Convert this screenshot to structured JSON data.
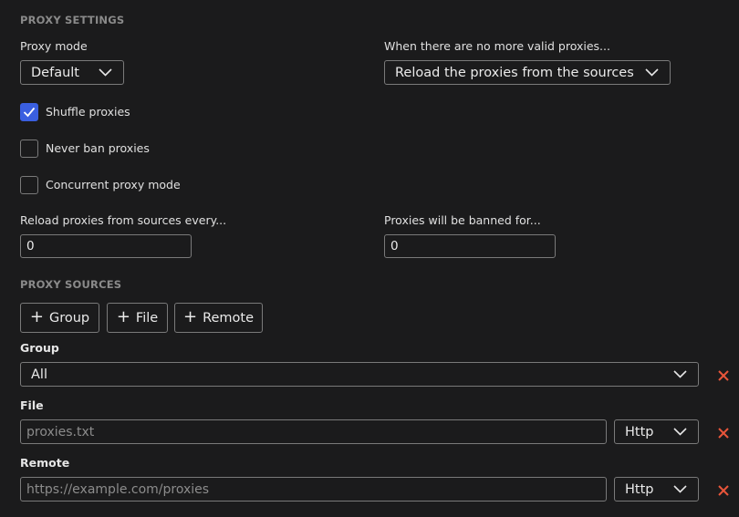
{
  "proxy_settings": {
    "title": "PROXY SETTINGS",
    "proxy_mode_label": "Proxy mode",
    "proxy_mode_value": "Default",
    "no_valid_label": "When there are no more valid proxies...",
    "no_valid_value": "Reload the proxies from the sources",
    "shuffle_label": "Shuffle proxies",
    "shuffle_checked": true,
    "never_ban_label": "Never ban proxies",
    "never_ban_checked": false,
    "concurrent_label": "Concurrent proxy mode",
    "concurrent_checked": false,
    "reload_label": "Reload proxies from sources every...",
    "reload_value": "0",
    "ban_label": "Proxies will be banned for...",
    "ban_value": "0"
  },
  "proxy_sources": {
    "title": "PROXY SOURCES",
    "add_group_label": "Group",
    "add_file_label": "File",
    "add_remote_label": "Remote",
    "group": {
      "label": "Group",
      "value": "All"
    },
    "file": {
      "label": "File",
      "placeholder": "proxies.txt",
      "type_value": "Http"
    },
    "remote": {
      "label": "Remote",
      "placeholder": "https://example.com/proxies",
      "type_value": "Http"
    }
  },
  "colors": {
    "background": "#1b1b1c",
    "accent": "#3a5fe0",
    "remove": "#e8553a"
  },
  "icons": {
    "dropdown": "chevron-down-icon",
    "check": "check-icon",
    "add": "plus-icon",
    "remove": "close-icon"
  }
}
